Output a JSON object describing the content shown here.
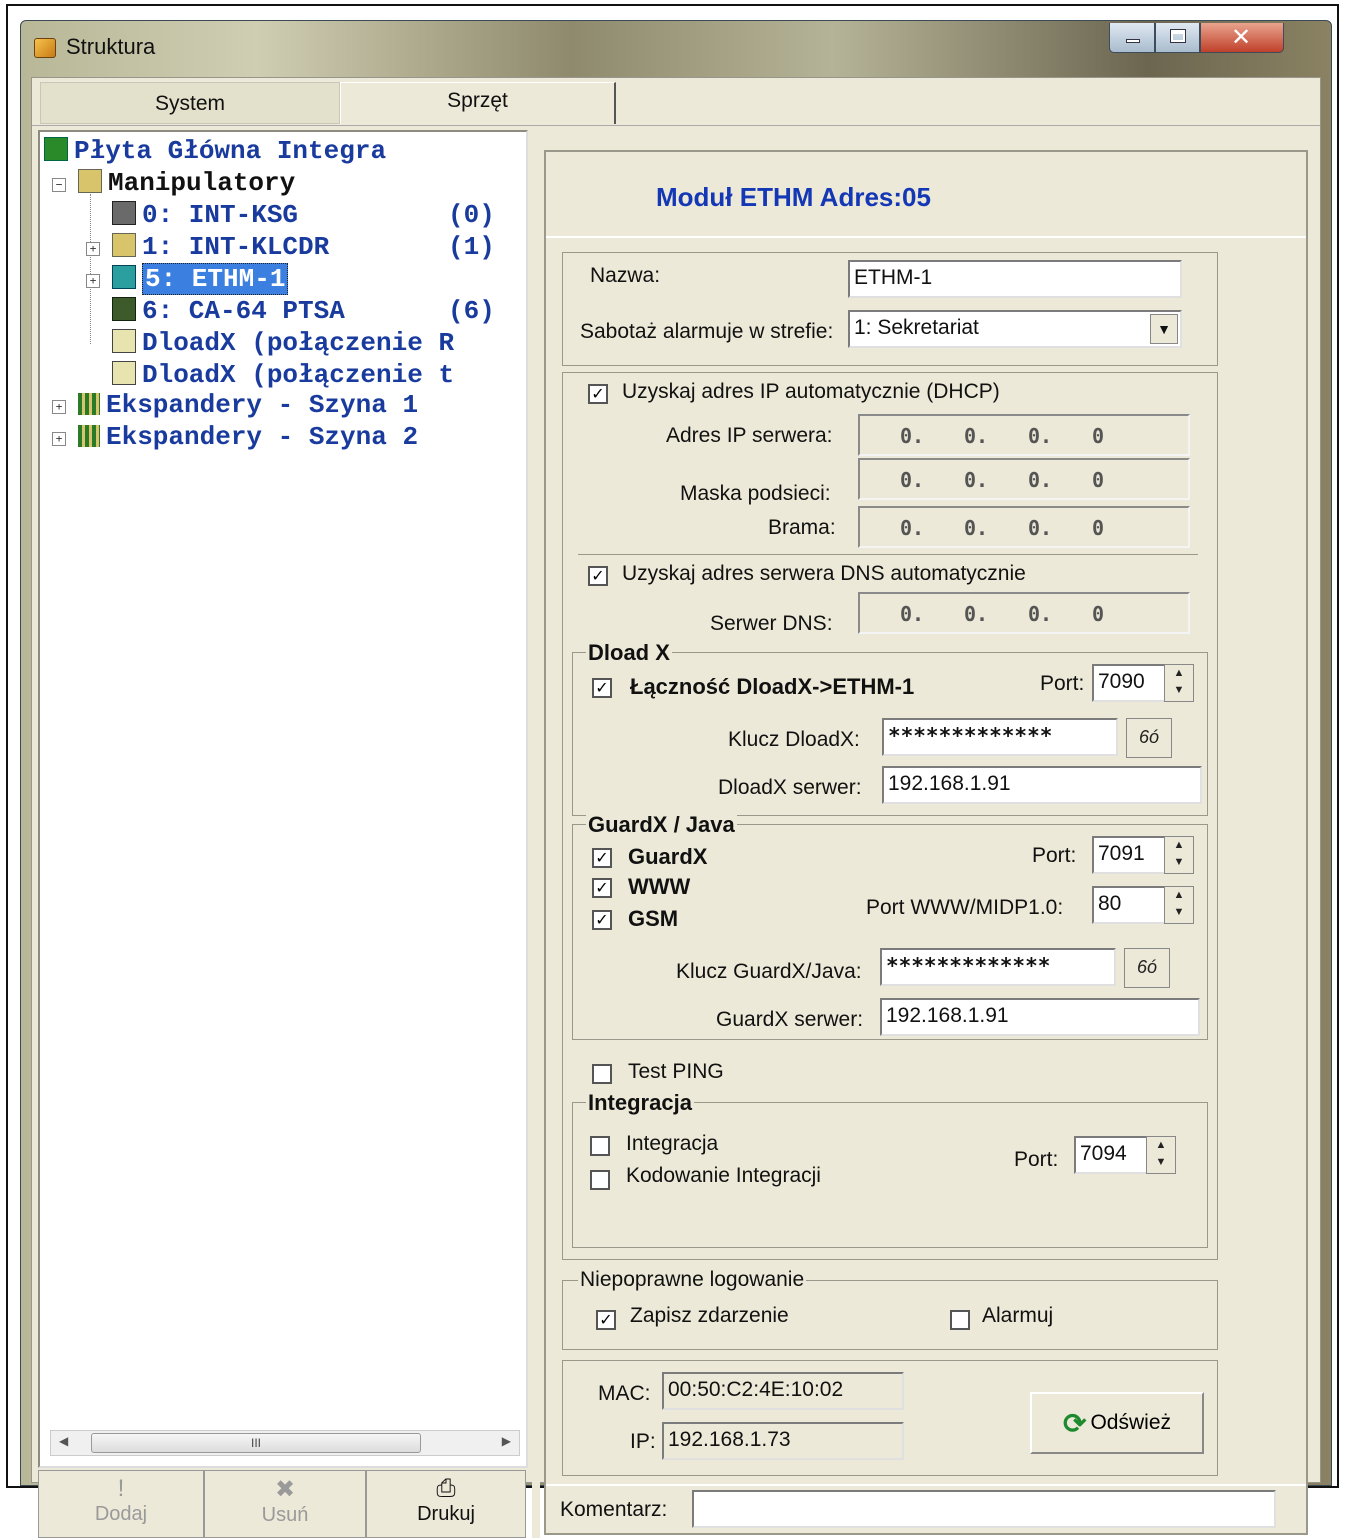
{
  "window": {
    "title": "Struktura"
  },
  "tabs": [
    {
      "label": "System"
    },
    {
      "label": "Sprzęt"
    }
  ],
  "tree": {
    "root": "Płyta Główna Integra",
    "manipulatory": "Manipulatory",
    "items": [
      {
        "label": "0: INT-KSG",
        "count": "(0)"
      },
      {
        "label": "1: INT-KLCDR",
        "count": "(1)"
      },
      {
        "label": "5: ETHM-1",
        "count": ""
      },
      {
        "label": "6: CA-64 PTSA",
        "count": "(6)"
      },
      {
        "label": "DloadX (połączenie R",
        "count": ""
      },
      {
        "label": "DloadX (połączenie t",
        "count": ""
      }
    ],
    "exp1": "Ekspandery - Szyna 1",
    "exp2": "Ekspandery - Szyna 2",
    "scroll_label": "III"
  },
  "bottom_buttons": {
    "add": "Dodaj",
    "remove": "Usuń",
    "print": "Drukuj"
  },
  "header": {
    "title": "Moduł ETHM Adres:05"
  },
  "form": {
    "name_label": "Nazwa:",
    "name_value": "ETHM-1",
    "tamper_label": "Sabotaż alarmuje w strefie:",
    "tamper_value": "1: Sekretariat",
    "dhcp_label": "Uzyskaj adres IP automatycznie (DHCP)",
    "dhcp_checked": true,
    "ip_label": "Adres IP serwera:",
    "mask_label": "Maska podsieci:",
    "gateway_label": "Brama:",
    "ip_value": [
      "0.",
      "0.",
      "0.",
      "0"
    ],
    "dns_auto_label": "Uzyskaj adres serwera DNS automatycznie",
    "dns_auto_checked": true,
    "dns_label": "Serwer DNS:"
  },
  "dloadx": {
    "group_title": "Dload X",
    "conn_label": "Łączność DloadX->ETHM-1",
    "conn_checked": true,
    "port_label": "Port:",
    "port_value": "7090",
    "key_label": "Klucz DloadX:",
    "key_value": "*************",
    "eye": "6ó",
    "server_label": "DloadX serwer:",
    "server_value": "192.168.1.91"
  },
  "guardx": {
    "group_title": "GuardX / Java",
    "guardx_label": "GuardX",
    "www_label": "WWW",
    "gsm_label": "GSM",
    "port_label": "Port:",
    "port_value": "7091",
    "www_port_label": "Port WWW/MIDP1.0:",
    "www_port_value": "80",
    "key_label": "Klucz GuardX/Java:",
    "key_value": "*************",
    "eye": "6ó",
    "server_label": "GuardX serwer:",
    "server_value": "192.168.1.91"
  },
  "ping": {
    "label": "Test PING",
    "checked": false
  },
  "integration": {
    "group_title": "Integracja",
    "integration_label": "Integracja",
    "encoding_label": "Kodowanie Integracji",
    "port_label": "Port:",
    "port_value": "7094"
  },
  "login": {
    "group_title": "Niepoprawne logowanie",
    "save_label": "Zapisz zdarzenie",
    "save_checked": true,
    "alarm_label": "Alarmuj",
    "alarm_checked": false
  },
  "status": {
    "mac_label": "MAC:",
    "mac_value": "00:50:C2:4E:10:02",
    "ip_label": "IP:",
    "ip_value": "192.168.1.73",
    "refresh_label": "Odśwież"
  },
  "comment": {
    "label": "Komentarz:",
    "value": ""
  },
  "colors": {
    "tree_text": "#1a3b9e",
    "header_title": "#1337b5",
    "selection": "#3b7fe0",
    "window_bg": "#ece9d8"
  }
}
